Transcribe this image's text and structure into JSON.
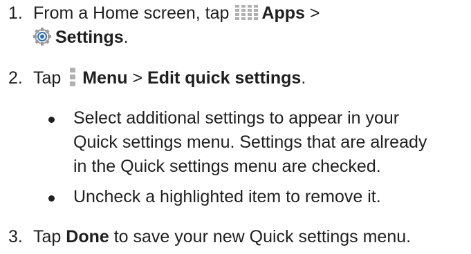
{
  "steps": [
    {
      "number": "1.",
      "pre": "From a Home screen, tap",
      "apps_label": "Apps",
      "sep": " >",
      "settings_label": "Settings",
      "end": "."
    },
    {
      "number": "2.",
      "pre": "Tap",
      "menu_label": "Menu",
      "sep": " > ",
      "edit_label": "Edit quick settings",
      "end": "."
    },
    {
      "number": "3.",
      "pre": "Tap ",
      "done_label": "Done",
      "post": " to save your new Quick settings menu."
    }
  ],
  "bullets": [
    {
      "lines": [
        "Select additional settings to appear in your",
        "Quick settings menu. Settings that are already",
        "in the Quick settings menu are checked."
      ]
    },
    {
      "lines": [
        "Uncheck a highlighted item to remove it."
      ]
    }
  ],
  "icons": {
    "apps": "apps-grid-icon",
    "settings": "gear-icon",
    "menu": "vertical-dots-menu-icon"
  },
  "colors": {
    "text": "#1f1f1f",
    "icon_gray": "#b0b0b0",
    "gear_blue": "#2f6fb0"
  }
}
